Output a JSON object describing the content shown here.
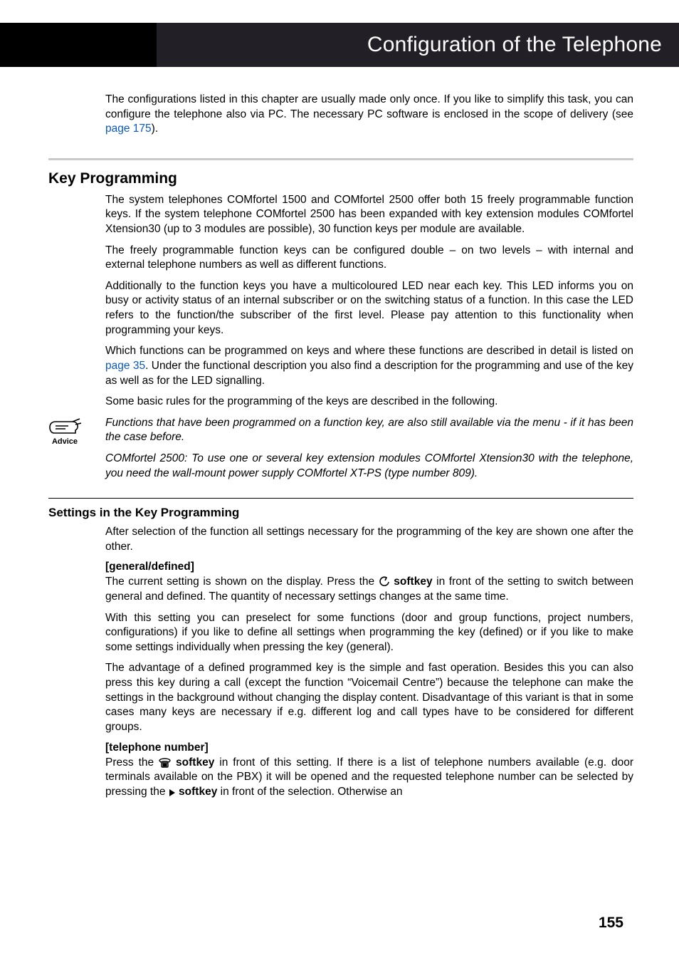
{
  "header": {
    "title": "Configuration of the Telephone"
  },
  "intro": {
    "part1": "The configurations listed in this chapter are usually made only once. If you like to simplify this task, you can configure the telephone also via PC. The necessary PC software is enclosed in the scope of delivery (see ",
    "link": "page 175",
    "part2": ")."
  },
  "section1": {
    "heading": "Key Programming",
    "p1": "The system telephones COMfortel 1500 and COMfortel 2500 offer both 15 freely programmable function keys. If the system telephone COMfortel 2500 has been expanded with key extension modules COMfortel Xtension30 (up to 3 modules are possible), 30 function keys per module are available.",
    "p2": "The freely programmable function keys can be configured double – on two levels – with internal and external telephone numbers as well as different functions.",
    "p3": "Additionally to the function keys you have a multicoloured LED near each key. This LED informs you on busy or activity status of an internal subscriber or on the switching status of a function. In this case the LED refers to the function/the subscriber of the first level. Please pay attention to this functionality when programming your keys.",
    "p4a": "Which functions can be programmed on keys and where these functions are described in detail is listed on ",
    "p4link": "page 35",
    "p4b": ". Under the functional description you also find a description for the programming and use of the key as well as for the LED signalling.",
    "p5": "Some basic rules for the programming of the keys are described in the following.",
    "advice_label": "Advice",
    "advice1": "Functions that have been programmed on a function key, are also still available via the menu - if it has been the case before.",
    "advice2": "COMfortel 2500: To use one or several key extension modules COMfortel Xtension30 with the telephone, you need the wall-mount power supply COMfortel XT-PS (type number 809)."
  },
  "section2": {
    "heading": "Settings in the Key Programming",
    "p1": "After selection of the function all settings necessary for the programming of the key are shown one after the other.",
    "sub1": "[general/defined]",
    "sub1p1a": "The current setting is shown on the display. Press the ",
    "sub1p1b": " softkey",
    "sub1p1c": " in front of the setting to switch between general and defined. The quantity of necessary settings changes at the same time.",
    "sub1p2": "With this setting you can preselect for some functions (door and group functions, project numbers, configurations) if you like to define all settings when programming the key (defined) or if you like to make some settings individually when pressing the key (general).",
    "sub1p3": "The advantage of a defined programmed key is the simple and fast operation. Besides this you can also press this key during a call (except the function “Voicemail Centre”) because the telephone can make the settings in the background without changing the display content. Disadvantage of this variant is that in some cases many keys are necessary if e.g. different log and call types have to be considered for different groups.",
    "sub2": "[telephone number]",
    "sub2p1a": "Press the ",
    "sub2p1b": " softkey",
    "sub2p1c": " in front of this setting. If there is a list of telephone numbers available (e.g. door terminals available on the PBX) it will be opened and the requested telephone number can be selected by pressing the ",
    "sub2p1d": " softkey",
    "sub2p1e": " in front of the selection. Otherwise an"
  },
  "page_number": "155",
  "icons": {
    "advice": "advice-hand-icon",
    "toggle": "toggle-icon",
    "phone": "phone-icon",
    "play": "play-icon"
  }
}
